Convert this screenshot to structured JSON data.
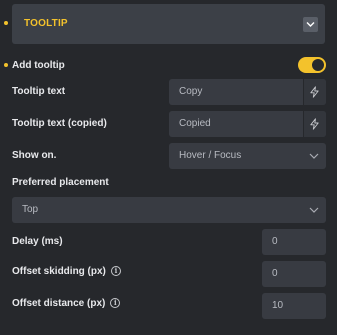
{
  "section": {
    "title": "TOOLTIP",
    "collapse_icon": "chevron-down-icon"
  },
  "add_tooltip": {
    "label": "Add tooltip",
    "enabled": true,
    "accent": "#f3c22c"
  },
  "tooltip_text": {
    "label": "Tooltip text",
    "value": "Copy",
    "icon": "bolt-icon"
  },
  "tooltip_text_copied": {
    "label": "Tooltip text (copied)",
    "value": "Copied",
    "icon": "bolt-icon"
  },
  "show_on": {
    "label": "Show on.",
    "value": "Hover / Focus"
  },
  "preferred_placement": {
    "label": "Preferred placement",
    "value": "Top"
  },
  "delay": {
    "label": "Delay (ms)",
    "value": "0"
  },
  "offset_skidding": {
    "label": "Offset skidding (px)",
    "value": "0",
    "info_icon": "info-icon"
  },
  "offset_distance": {
    "label": "Offset distance (px)",
    "value": "10",
    "info_icon": "info-icon"
  }
}
